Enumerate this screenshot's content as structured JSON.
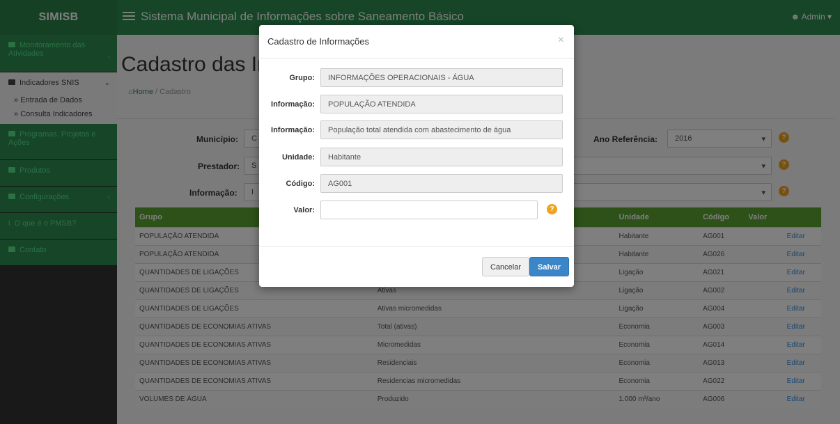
{
  "topbar": {
    "brand": "SIMISB",
    "title": "Sistema Municipal de Informações sobre Saneamento Básico",
    "user": "Admin"
  },
  "sidebar": {
    "items": [
      {
        "label": "Monitoramento das Atividades"
      },
      {
        "label": "Indicadores SNIS"
      },
      {
        "label": "Programas, Projetos e Ações"
      },
      {
        "label": "Produtos"
      },
      {
        "label": "Configurações"
      },
      {
        "label": "O que é o PMSB?"
      },
      {
        "label": "Contato"
      }
    ],
    "subitems": [
      {
        "label": "Entrada de Dados"
      },
      {
        "label": "Consulta Indicadores"
      }
    ]
  },
  "page": {
    "title": "Cadastro das Informações",
    "breadcrumb_home": "Home",
    "breadcrumb_current": "Cadastro"
  },
  "filters": {
    "municipio_label": "Município:",
    "municipio_value": "C",
    "prestador_label": "Prestador:",
    "prestador_value": "S",
    "informacao_label": "Informação:",
    "informacao_value": "I",
    "ano_label": "Ano Referência:",
    "ano_value": "2016"
  },
  "table": {
    "headers": [
      "Grupo",
      "Unidade",
      "Código",
      "Valor",
      ""
    ],
    "rows": [
      {
        "grupo": "POPULAÇÃO ATENDIDA",
        "info": "",
        "unidade": "Habitante",
        "codigo": "AG001",
        "valor": "",
        "acao": "Editar"
      },
      {
        "grupo": "POPULAÇÃO ATENDIDA",
        "info": "",
        "unidade": "Habitante",
        "codigo": "AG026",
        "valor": "",
        "acao": "Editar"
      },
      {
        "grupo": "QUANTIDADES DE LIGAÇÕES",
        "info": "",
        "unidade": "Ligação",
        "codigo": "AG021",
        "valor": "",
        "acao": "Editar"
      },
      {
        "grupo": "QUANTIDADES DE LIGAÇÕES",
        "info": "Ativas",
        "unidade": "Ligação",
        "codigo": "AG002",
        "valor": "",
        "acao": "Editar"
      },
      {
        "grupo": "QUANTIDADES DE LIGAÇÕES",
        "info": "Ativas micromedidas",
        "unidade": "Ligação",
        "codigo": "AG004",
        "valor": "",
        "acao": "Editar"
      },
      {
        "grupo": "QUANTIDADES DE ECONOMIAS ATIVAS",
        "info": "Total (ativas)",
        "unidade": "Economia",
        "codigo": "AG003",
        "valor": "",
        "acao": "Editar"
      },
      {
        "grupo": "QUANTIDADES DE ECONOMIAS ATIVAS",
        "info": "Micromedidas",
        "unidade": "Economia",
        "codigo": "AG014",
        "valor": "",
        "acao": "Editar"
      },
      {
        "grupo": "QUANTIDADES DE ECONOMIAS ATIVAS",
        "info": "Residenciais",
        "unidade": "Economia",
        "codigo": "AG013",
        "valor": "",
        "acao": "Editar"
      },
      {
        "grupo": "QUANTIDADES DE ECONOMIAS ATIVAS",
        "info": "Residencias micromedidas",
        "unidade": "Economia",
        "codigo": "AG022",
        "valor": "",
        "acao": "Editar"
      },
      {
        "grupo": "VOLUMES DE ÁGUA",
        "info": "Produzido",
        "unidade": "1.000 m³/ano",
        "codigo": "AG006",
        "valor": "",
        "acao": "Editar"
      }
    ]
  },
  "modal": {
    "title": "Cadastro de Informações",
    "close": "×",
    "grupo_label": "Grupo:",
    "grupo_value": "INFORMAÇÕES OPERACIONAIS - ÁGUA",
    "info1_label": "Informação:",
    "info1_value": "POPULAÇÃO ATENDIDA",
    "info2_label": "Informação:",
    "info2_value": "População total atendida com abastecimento de água",
    "unidade_label": "Unidade:",
    "unidade_value": "Habitante",
    "codigo_label": "Código:",
    "codigo_value": "AG001",
    "valor_label": "Valor:",
    "cancel": "Cancelar",
    "save": "Salvar",
    "help": "?"
  }
}
